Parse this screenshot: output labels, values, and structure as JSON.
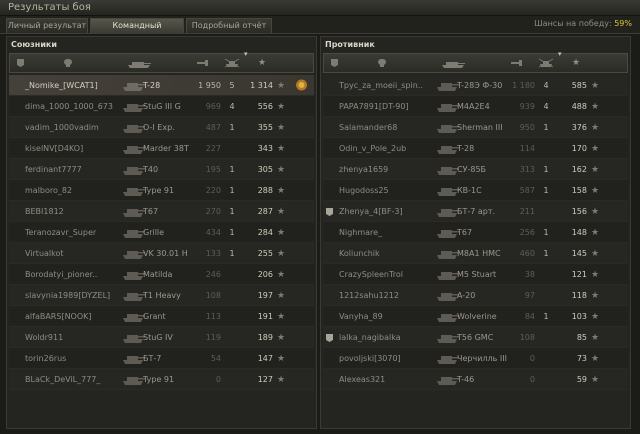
{
  "window": {
    "title": "Результаты боя"
  },
  "tabs": [
    {
      "label": "Личный результат",
      "active": false
    },
    {
      "label": "Командный результат",
      "active": true
    },
    {
      "label": "Подробный отчёт",
      "active": false
    }
  ],
  "win_chance": {
    "label": "Шансы на победу:",
    "value": "59%"
  },
  "allies": {
    "title": "Союзники",
    "rows": [
      {
        "name": "_Nomike_[WCAT1]",
        "tank": "T-28",
        "damage": "1 950",
        "kills": "5",
        "xp": "1 314",
        "highlight": true,
        "medal": true
      },
      {
        "name": "dima_1000_1000_673",
        "tank": "StuG III G",
        "damage": "969",
        "kills": "4",
        "xp": "556"
      },
      {
        "name": "vadim_1000vadim",
        "tank": "O-I Exp.",
        "damage": "487",
        "kills": "1",
        "xp": "355"
      },
      {
        "name": "kiselNV[D4KO]",
        "tank": "Marder 38T",
        "damage": "227",
        "kills": "",
        "xp": "343"
      },
      {
        "name": "ferdinant7777",
        "tank": "T40",
        "damage": "195",
        "kills": "1",
        "xp": "305"
      },
      {
        "name": "malboro_82",
        "tank": "Type 91",
        "damage": "220",
        "kills": "1",
        "xp": "288"
      },
      {
        "name": "BEBI1812",
        "tank": "T67",
        "damage": "270",
        "kills": "1",
        "xp": "287"
      },
      {
        "name": "Teranozavr_Super",
        "tank": "Grille",
        "damage": "434",
        "kills": "1",
        "xp": "284"
      },
      {
        "name": "Virtualkot",
        "tank": "VK 30.01 H",
        "damage": "133",
        "kills": "1",
        "xp": "255"
      },
      {
        "name": "Borodatyi_pioner..",
        "tank": "Matilda",
        "damage": "246",
        "kills": "",
        "xp": "206"
      },
      {
        "name": "slavynia1989[DYZEL]",
        "tank": "T1 Heavy",
        "damage": "108",
        "kills": "",
        "xp": "197"
      },
      {
        "name": "alfaBARS[NOOK]",
        "tank": "Grant",
        "damage": "113",
        "kills": "",
        "xp": "191"
      },
      {
        "name": "Woldr911",
        "tank": "StuG IV",
        "damage": "119",
        "kills": "",
        "xp": "189"
      },
      {
        "name": "torin26rus",
        "tank": "БТ-7",
        "damage": "54",
        "kills": "",
        "xp": "147"
      },
      {
        "name": "BLaCk_DeViL_777_",
        "tank": "Type 91",
        "damage": "0",
        "kills": "",
        "xp": "127"
      }
    ]
  },
  "enemies": {
    "title": "Противник",
    "rows": [
      {
        "name": "Tpyc_za_moeii_spin..",
        "tank": "T-28Э Ф-30",
        "damage": "1 180",
        "kills": "4",
        "xp": "585"
      },
      {
        "name": "PAPA7891[DT-90]",
        "tank": "M4A2E4",
        "damage": "939",
        "kills": "4",
        "xp": "488"
      },
      {
        "name": "Salamander68",
        "tank": "Sherman III",
        "damage": "950",
        "kills": "1",
        "xp": "376"
      },
      {
        "name": "Odin_v_Pole_2ub",
        "tank": "T-28",
        "damage": "114",
        "kills": "",
        "xp": "170"
      },
      {
        "name": "zhenya1659",
        "tank": "СУ-85Б",
        "damage": "313",
        "kills": "1",
        "xp": "162"
      },
      {
        "name": "Hugodoss25",
        "tank": "КВ-1С",
        "damage": "587",
        "kills": "1",
        "xp": "158"
      },
      {
        "name": "Zhenya_4[BF-3]",
        "tank": "БТ-7 арт.",
        "damage": "211",
        "kills": "",
        "xp": "156",
        "flag": true
      },
      {
        "name": "Nighmare_",
        "tank": "T67",
        "damage": "256",
        "kills": "1",
        "xp": "148"
      },
      {
        "name": "Koliunchik",
        "tank": "M8A1 HMC",
        "damage": "460",
        "kills": "1",
        "xp": "145"
      },
      {
        "name": "CrazySpleenTrol",
        "tank": "M5 Stuart",
        "damage": "38",
        "kills": "",
        "xp": "121"
      },
      {
        "name": "1212sahu1212",
        "tank": "A-20",
        "damage": "97",
        "kills": "",
        "xp": "118"
      },
      {
        "name": "Vanyha_89",
        "tank": "Wolverine",
        "damage": "84",
        "kills": "1",
        "xp": "103"
      },
      {
        "name": "lalka_nagibalka",
        "tank": "T56 GMC",
        "damage": "108",
        "kills": "",
        "xp": "85",
        "flag": true
      },
      {
        "name": "povoljski[3070]",
        "tank": "Черчилль III",
        "damage": "0",
        "kills": "",
        "xp": "73"
      },
      {
        "name": "Alexeas321",
        "tank": "T-46",
        "damage": "0",
        "kills": "",
        "xp": "59"
      }
    ]
  },
  "icons": {
    "flag": "flag-icon",
    "tank": "tank-icon",
    "gun": "gun-icon",
    "kills": "kills-icon",
    "xp": "star-icon",
    "medal": "medal-icon"
  },
  "colors": {
    "accent": "#d8c53e",
    "highlight_row": "#45403a"
  }
}
